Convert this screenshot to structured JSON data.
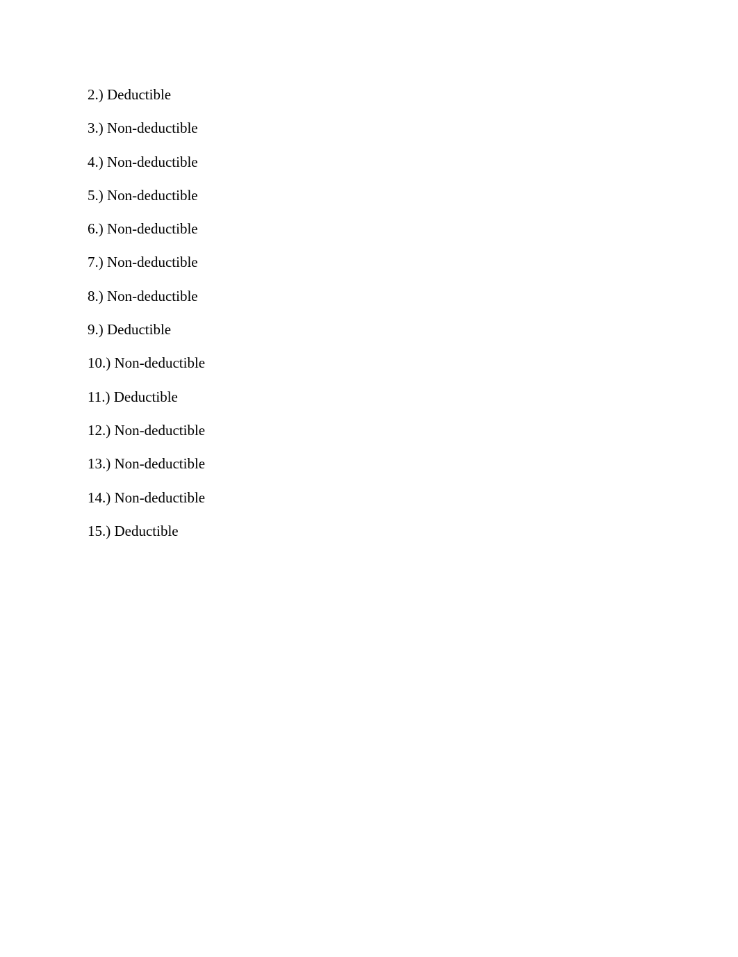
{
  "document": {
    "items": [
      {
        "number": "2.)",
        "answer": "Deductible"
      },
      {
        "number": "3.)",
        "answer": "Non-deductible"
      },
      {
        "number": "4.)",
        "answer": "Non-deductible"
      },
      {
        "number": "5.)",
        "answer": "Non-deductible"
      },
      {
        "number": "6.)",
        "answer": "Non-deductible"
      },
      {
        "number": "7.)",
        "answer": "Non-deductible"
      },
      {
        "number": "8.)",
        "answer": "Non-deductible"
      },
      {
        "number": "9.)",
        "answer": "Deductible"
      },
      {
        "number": "10.)",
        "answer": "Non-deductible"
      },
      {
        "number": "11.)",
        "answer": "Deductible"
      },
      {
        "number": "12.)",
        "answer": "Non-deductible"
      },
      {
        "number": "13.)",
        "answer": "Non-deductible"
      },
      {
        "number": "14.)",
        "answer": "Non-deductible"
      },
      {
        "number": "15.)",
        "answer": "Deductible"
      }
    ]
  }
}
